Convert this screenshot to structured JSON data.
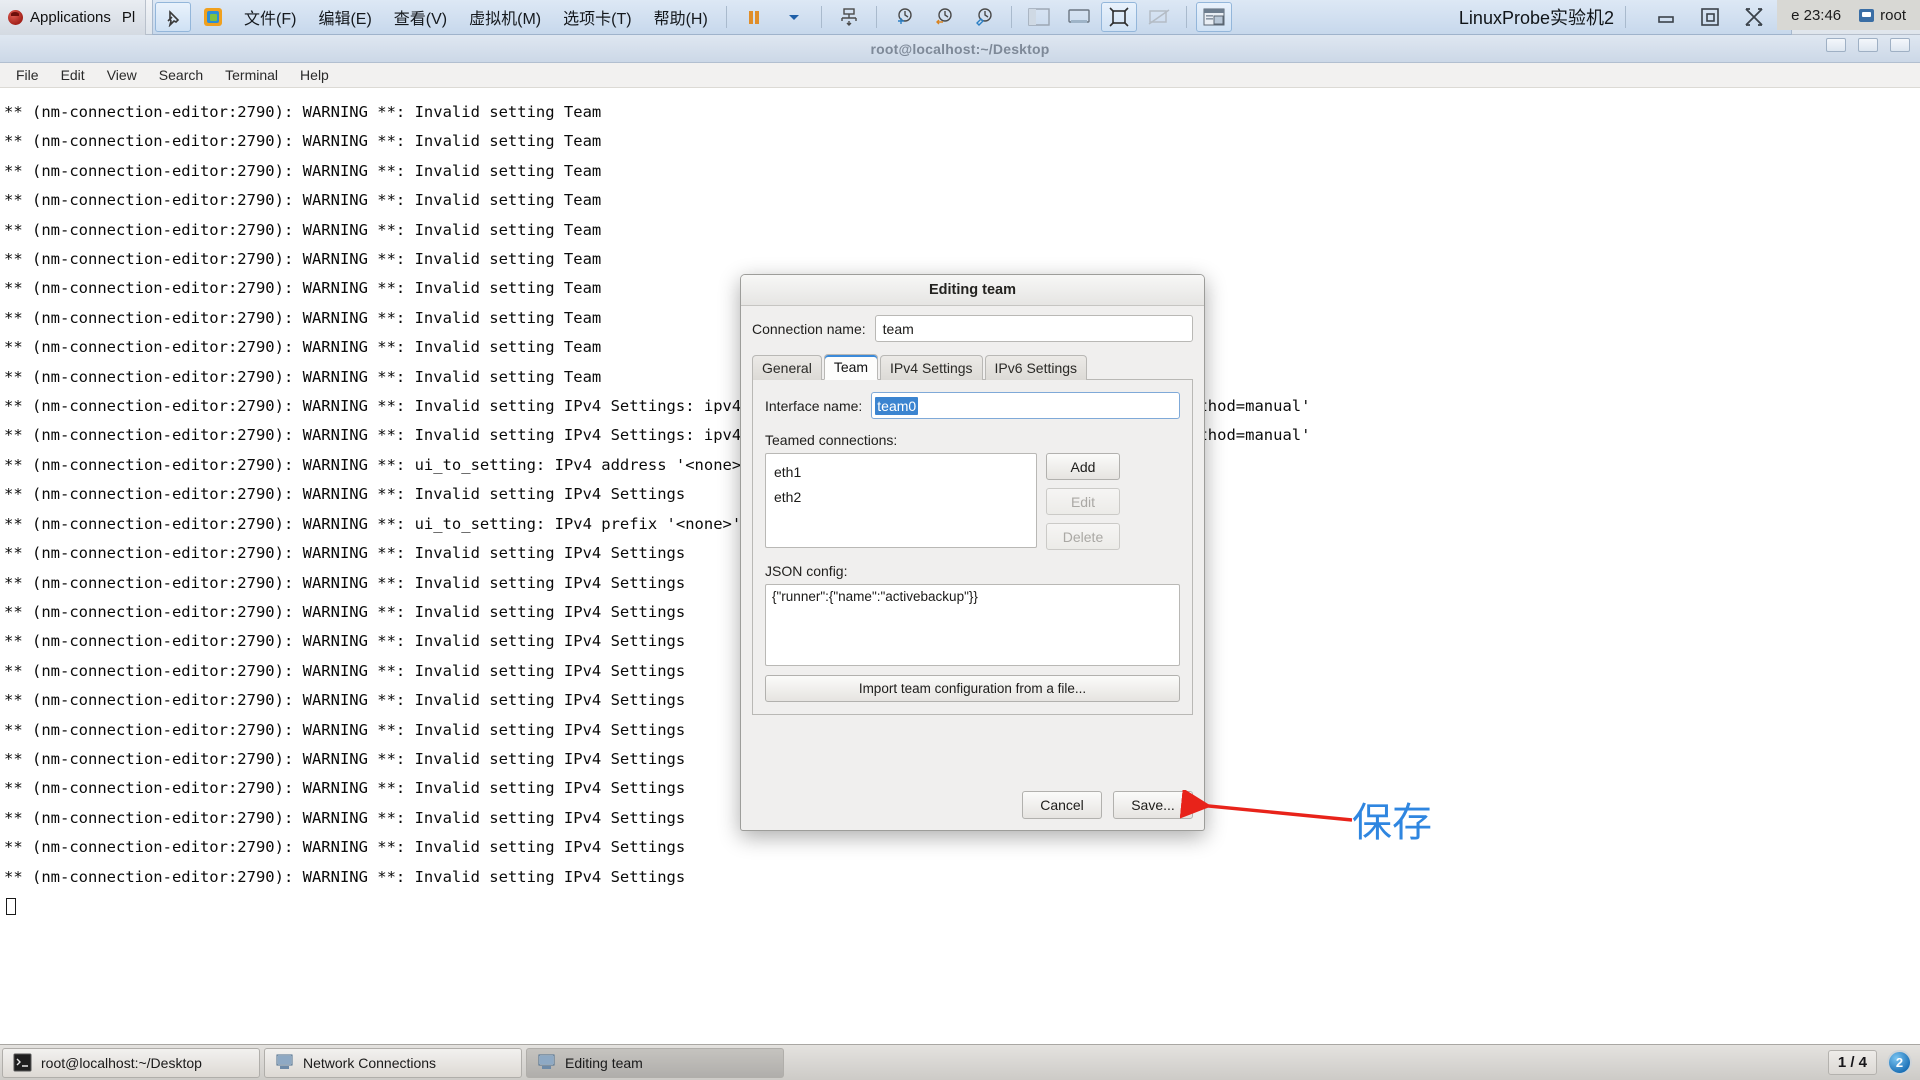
{
  "vmware": {
    "applications_label": "Applications",
    "places_label": "Pl",
    "menus": [
      {
        "text": "文件(F)",
        "name": "file"
      },
      {
        "text": "编辑(E)",
        "name": "edit"
      },
      {
        "text": "查看(V)",
        "name": "view"
      },
      {
        "text": "虚拟机(M)",
        "name": "vm"
      },
      {
        "text": "选项卡(T)",
        "name": "tabs"
      },
      {
        "text": "帮助(H)",
        "name": "help"
      }
    ],
    "vm_title": "LinuxProbe实验机2",
    "icons": {
      "pin": "pin-icon",
      "vmware_logo": "vmware-logo-icon",
      "pause": "pause-icon",
      "dropdown": "chevron-down-icon",
      "send_key": "send-ctrl-alt-del-icon",
      "snapshot_add": "snapshot-add-icon",
      "snapshot_revert": "snapshot-revert-icon",
      "snapshot_manage": "snapshot-manager-icon",
      "sidebar": "show-sidebar-icon",
      "console": "console-view-icon",
      "fullscreen": "fullscreen-icon",
      "unity": "unity-mode-icon",
      "thumbnail": "thumbnail-bar-icon",
      "minimize": "minimize-icon",
      "maximize": "maximize-icon",
      "close": "close-icon"
    },
    "host_clock": "e 23:46",
    "host_user": "root"
  },
  "terminal": {
    "window_title": "root@localhost:~/Desktop",
    "menubar": [
      "File",
      "Edit",
      "View",
      "Search",
      "Terminal",
      "Help"
    ],
    "lines": [
      "** (nm-connection-editor:2790): WARNING **: Invalid setting Team",
      "** (nm-connection-editor:2790): WARNING **: Invalid setting Team",
      "** (nm-connection-editor:2790): WARNING **: Invalid setting Team",
      "** (nm-connection-editor:2790): WARNING **: Invalid setting Team",
      "** (nm-connection-editor:2790): WARNING **: Invalid setting Team",
      "** (nm-connection-editor:2790): WARNING **: Invalid setting Team",
      "** (nm-connection-editor:2790): WARNING **: Invalid setting Team",
      "** (nm-connection-editor:2790): WARNING **: Invalid setting Team",
      "** (nm-connection-editor:2790): WARNING **: Invalid setting Team",
      "** (nm-connection-editor:2790): WARNING **: Invalid setting Team",
      "** (nm-connection-editor:2790): WARNING **: Invalid setting IPv4 Settings: ipv4.addresses: this property cannot be empty for 'method=manual'",
      "** (nm-connection-editor:2790): WARNING **: Invalid setting IPv4 Settings: ipv4.addresses: this property cannot be empty for 'method=manual'",
      "** (nm-connection-editor:2790): WARNING **: ui_to_setting: IPv4 address '<none>' missing",
      "** (nm-connection-editor:2790): WARNING **: Invalid setting IPv4 Settings",
      "** (nm-connection-editor:2790): WARNING **: ui_to_setting: IPv4 prefix '<none>' missing",
      "** (nm-connection-editor:2790): WARNING **: Invalid setting IPv4 Settings",
      "** (nm-connection-editor:2790): WARNING **: Invalid setting IPv4 Settings",
      "** (nm-connection-editor:2790): WARNING **: Invalid setting IPv4 Settings",
      "** (nm-connection-editor:2790): WARNING **: Invalid setting IPv4 Settings",
      "** (nm-connection-editor:2790): WARNING **: Invalid setting IPv4 Settings",
      "** (nm-connection-editor:2790): WARNING **: Invalid setting IPv4 Settings",
      "** (nm-connection-editor:2790): WARNING **: Invalid setting IPv4 Settings",
      "** (nm-connection-editor:2790): WARNING **: Invalid setting IPv4 Settings",
      "** (nm-connection-editor:2790): WARNING **: Invalid setting IPv4 Settings",
      "** (nm-connection-editor:2790): WARNING **: Invalid setting IPv4 Settings",
      "** (nm-connection-editor:2790): WARNING **: Invalid setting IPv4 Settings",
      "** (nm-connection-editor:2790): WARNING **: Invalid setting IPv4 Settings"
    ]
  },
  "dialog": {
    "title": "Editing team",
    "connection_name_label": "Connection name:",
    "connection_name_value": "team",
    "tabs": [
      {
        "label": "General",
        "active": false
      },
      {
        "label": "Team",
        "active": true
      },
      {
        "label": "IPv4 Settings",
        "active": false
      },
      {
        "label": "IPv6 Settings",
        "active": false
      }
    ],
    "interface_name_label": "Interface name:",
    "interface_name_value": "team0",
    "teamed_connections_label": "Teamed connections:",
    "teamed_connections": [
      "eth1",
      "eth2"
    ],
    "buttons": {
      "add": "Add",
      "edit": "Edit",
      "delete": "Delete",
      "import": "Import team configuration from a file...",
      "cancel": "Cancel",
      "save": "Save..."
    },
    "json_config_label": "JSON config:",
    "json_config_value": "{\"runner\":{\"name\":\"activebackup\"}}"
  },
  "annotation": {
    "text": "保存",
    "color": "#2f86e0",
    "arrow_color": "#e8231a"
  },
  "taskbar": {
    "items": [
      {
        "label": "root@localhost:~/Desktop",
        "icon": "terminal-icon",
        "active": false
      },
      {
        "label": "Network Connections",
        "icon": "network-icon",
        "active": false
      },
      {
        "label": "Editing team",
        "icon": "network-icon",
        "active": true
      }
    ],
    "workspace": "1 / 4",
    "workspace_badge": "2"
  }
}
